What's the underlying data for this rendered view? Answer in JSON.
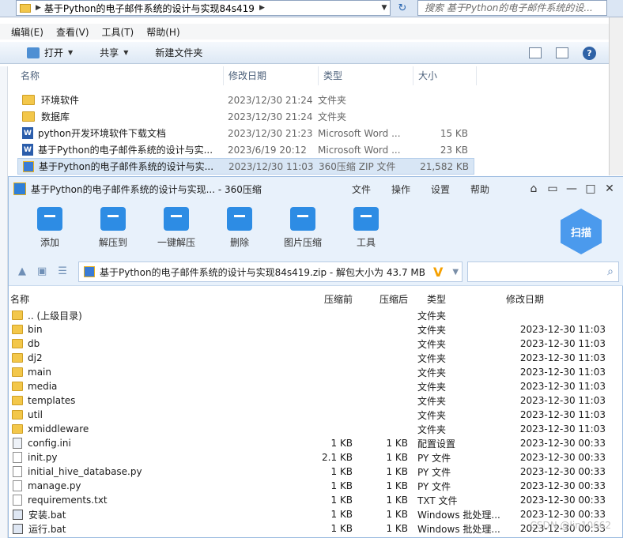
{
  "explorer": {
    "breadcrumb": "基于Python的电子邮件系统的设计与实现84s419",
    "search_placeholder": "搜索 基于Python的电子邮件系统的设...",
    "menu": [
      "编辑(E)",
      "查看(V)",
      "工具(T)",
      "帮助(H)"
    ],
    "toolbar": {
      "open": "打开",
      "share": "共享",
      "new_folder": "新建文件夹"
    },
    "columns": {
      "name": "名称",
      "date": "修改日期",
      "type": "类型",
      "size": "大小"
    },
    "files": [
      {
        "name": "环境软件",
        "date": "2023/12/30 21:24",
        "type": "文件夹",
        "size": "",
        "icon": "folder-icon"
      },
      {
        "name": "数据库",
        "date": "2023/12/30 21:24",
        "type": "文件夹",
        "size": "",
        "icon": "folder-icon"
      },
      {
        "name": "python开发环境软件下载文档",
        "date": "2023/12/30 21:23",
        "type": "Microsoft Word ...",
        "size": "15 KB",
        "icon": "word-doc-icon"
      },
      {
        "name": "基于Python的电子邮件系统的设计与实...",
        "date": "2023/6/19 20:12",
        "type": "Microsoft Word ...",
        "size": "23 KB",
        "icon": "word-doc-icon"
      },
      {
        "name": "基于Python的电子邮件系统的设计与实...",
        "date": "2023/12/30 11:03",
        "type": "360压缩 ZIP 文件",
        "size": "21,582 KB",
        "icon": "zip-icon"
      }
    ]
  },
  "zip": {
    "title": "基于Python的电子邮件系统的设计与实现... - 360压缩",
    "menu": [
      "文件",
      "操作",
      "设置",
      "帮助"
    ],
    "tools": [
      "添加",
      "解压到",
      "一键解压",
      "删除",
      "图片压缩",
      "工具"
    ],
    "scan_label": "扫描",
    "path": "基于Python的电子邮件系统的设计与实现84s419.zip - 解包大小为 43.7 MB",
    "columns": {
      "name": "名称",
      "compressed_before": "压缩前",
      "compressed_after": "压缩后",
      "type": "类型",
      "date": "修改日期"
    },
    "entries": [
      {
        "name": ".. (上级目录)",
        "before": "",
        "after": "",
        "type": "文件夹",
        "date": "",
        "icon": "folder"
      },
      {
        "name": "bin",
        "before": "",
        "after": "",
        "type": "文件夹",
        "date": "2023-12-30 11:03",
        "icon": "folder"
      },
      {
        "name": "db",
        "before": "",
        "after": "",
        "type": "文件夹",
        "date": "2023-12-30 11:03",
        "icon": "folder"
      },
      {
        "name": "dj2",
        "before": "",
        "after": "",
        "type": "文件夹",
        "date": "2023-12-30 11:03",
        "icon": "folder"
      },
      {
        "name": "main",
        "before": "",
        "after": "",
        "type": "文件夹",
        "date": "2023-12-30 11:03",
        "icon": "folder"
      },
      {
        "name": "media",
        "before": "",
        "after": "",
        "type": "文件夹",
        "date": "2023-12-30 11:03",
        "icon": "folder"
      },
      {
        "name": "templates",
        "before": "",
        "after": "",
        "type": "文件夹",
        "date": "2023-12-30 11:03",
        "icon": "folder"
      },
      {
        "name": "util",
        "before": "",
        "after": "",
        "type": "文件夹",
        "date": "2023-12-30 11:03",
        "icon": "folder"
      },
      {
        "name": "xmiddleware",
        "before": "",
        "after": "",
        "type": "文件夹",
        "date": "2023-12-30 11:03",
        "icon": "folder"
      },
      {
        "name": "config.ini",
        "before": "1 KB",
        "after": "1 KB",
        "type": "配置设置",
        "date": "2023-12-30 00:33",
        "icon": "config"
      },
      {
        "name": "init.py",
        "before": "2.1 KB",
        "after": "1 KB",
        "type": "PY 文件",
        "date": "2023-12-30 00:33",
        "icon": "file"
      },
      {
        "name": "initial_hive_database.py",
        "before": "1 KB",
        "after": "1 KB",
        "type": "PY 文件",
        "date": "2023-12-30 00:33",
        "icon": "file"
      },
      {
        "name": "manage.py",
        "before": "1 KB",
        "after": "1 KB",
        "type": "PY 文件",
        "date": "2023-12-30 00:33",
        "icon": "file"
      },
      {
        "name": "requirements.txt",
        "before": "1 KB",
        "after": "1 KB",
        "type": "TXT 文件",
        "date": "2023-12-30 00:33",
        "icon": "file"
      },
      {
        "name": "安装.bat",
        "before": "1 KB",
        "after": "1 KB",
        "type": "Windows 批处理...",
        "date": "2023-12-30 00:33",
        "icon": "bat"
      },
      {
        "name": "运行.bat",
        "before": "1 KB",
        "after": "1 KB",
        "type": "Windows 批处理...",
        "date": "2023-12-30 00:33",
        "icon": "bat"
      }
    ],
    "watermark": "CSDN @lin10662"
  }
}
